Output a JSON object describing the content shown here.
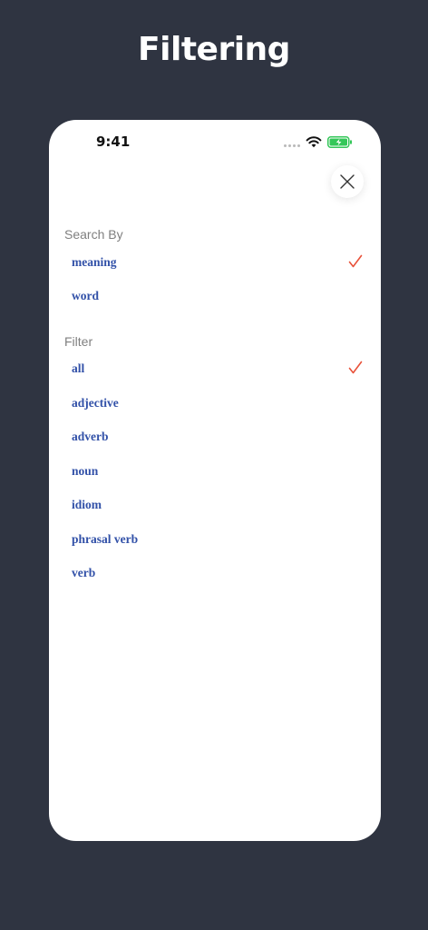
{
  "page": {
    "title": "Filtering"
  },
  "status_bar": {
    "time": "9:41"
  },
  "close_button": {
    "icon": "close-icon"
  },
  "search_by": {
    "header": "Search By",
    "options": [
      {
        "label": "meaning",
        "selected": true
      },
      {
        "label": "word",
        "selected": false
      }
    ]
  },
  "filter": {
    "header": "Filter",
    "options": [
      {
        "label": "all",
        "selected": true
      },
      {
        "label": "adjective",
        "selected": false
      },
      {
        "label": "adverb",
        "selected": false
      },
      {
        "label": "noun",
        "selected": false
      },
      {
        "label": "idiom",
        "selected": false
      },
      {
        "label": "phrasal verb",
        "selected": false
      },
      {
        "label": "verb",
        "selected": false
      }
    ]
  },
  "colors": {
    "background": "#2f3441",
    "option_text": "#3251a8",
    "check": "#e8523a",
    "header_text": "#7f7f7f",
    "battery": "#34c759"
  }
}
